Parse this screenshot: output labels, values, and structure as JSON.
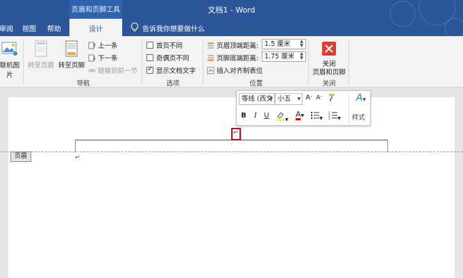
{
  "window": {
    "title": "文档1 - Word",
    "context_group": "页眉和页脚工具"
  },
  "tabs": [
    {
      "label": "审阅"
    },
    {
      "label": "视图"
    },
    {
      "label": "帮助"
    }
  ],
  "active_tab": {
    "label": "设计"
  },
  "tell_me": {
    "label": "告诉我你想要做什么"
  },
  "ribbon": {
    "groups": {
      "first": {
        "btn_label": "联机图片"
      },
      "navigation": {
        "label": "导航",
        "goto_header": "转至页眉",
        "goto_footer": "转至页脚",
        "previous": "上一条",
        "next": "下一条",
        "link_previous": "链接到前一节"
      },
      "options": {
        "label": "选项",
        "first_page": "首页不同",
        "odd_even": "奇偶页不同",
        "show_text": "显示文档文字",
        "show_text_checked": true
      },
      "position": {
        "label": "位置",
        "header_top_label": "页眉顶端距离:",
        "header_top_value": "1.5 厘米",
        "footer_bottom_label": "页脚底端距离:",
        "footer_bottom_value": "1.75 厘米",
        "insert_tab": "插入对齐制表位"
      },
      "close": {
        "label": "关闭",
        "btn_line1": "关闭",
        "btn_line2": "页眉和页脚"
      }
    }
  },
  "document": {
    "header_tag": "页眉",
    "para_mark": "↵"
  },
  "mini_toolbar": {
    "font": "等线 (西文",
    "size": "小五",
    "bold": "B",
    "italic": "I",
    "underline": "U",
    "styles_label": "样式"
  },
  "colors": {
    "title_bar": "#2b579a",
    "ribbon": "#f3f3f3",
    "highlight_yellow": "#ffff00",
    "font_red": "#e00000",
    "close_red": "#e23c2c"
  }
}
